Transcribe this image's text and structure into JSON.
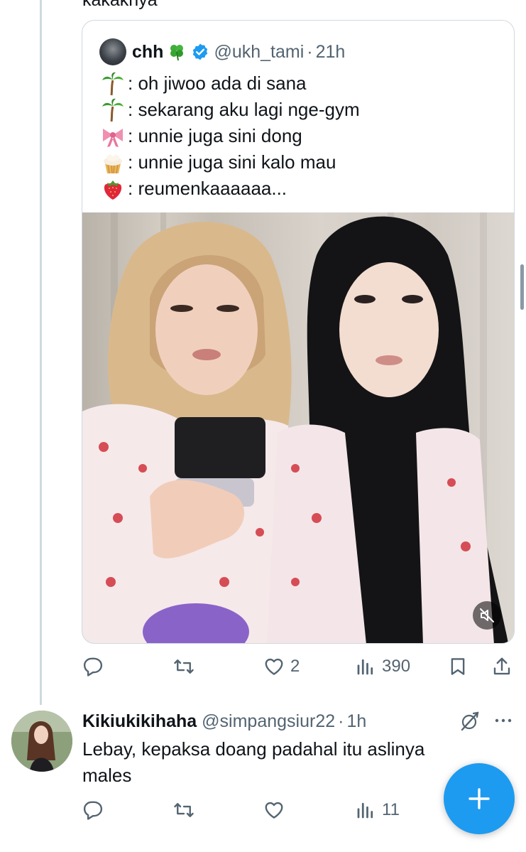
{
  "prev_tweet": {
    "clipped_text": "kakaknya"
  },
  "quote": {
    "author_name": "chh",
    "name_emoji": "clover-icon",
    "verified": true,
    "handle": "@ukh_tami",
    "dot": "·",
    "time": "21h",
    "lines": [
      {
        "emoji": "palm-tree-icon",
        "text": ": oh jiwoo ada di sana"
      },
      {
        "emoji": "palm-tree-icon",
        "text": ": sekarang aku lagi nge-gym"
      },
      {
        "emoji": "ribbon-icon",
        "text": ": unnie juga sini dong"
      },
      {
        "emoji": "cupcake-icon",
        "text": ": unnie juga sini kalo mau"
      },
      {
        "emoji": "strawberry-icon",
        "text": ": reumenkaaaaaa..."
      }
    ],
    "media": {
      "type": "video",
      "muted": true,
      "mute_icon": "speaker-muted-icon"
    }
  },
  "quote_actions": {
    "reply_count": "",
    "retweet_count": "",
    "like_count": "2",
    "views_count": "390"
  },
  "reply": {
    "author_name": "Kikiukikihaha",
    "handle": "@simpangsiur22",
    "dot": "·",
    "time": "1h",
    "text": "Lebay, kepaksa doang padahal itu aslinya males",
    "actions": {
      "reply_count": "",
      "retweet_count": "",
      "like_count": "",
      "views_count": "11"
    }
  },
  "fab": {
    "icon": "plus-icon",
    "label": "+"
  },
  "colors": {
    "accent": "#1d9bf0",
    "secondary_text": "#536471",
    "border": "#cfd9de",
    "text": "#0f1419"
  }
}
